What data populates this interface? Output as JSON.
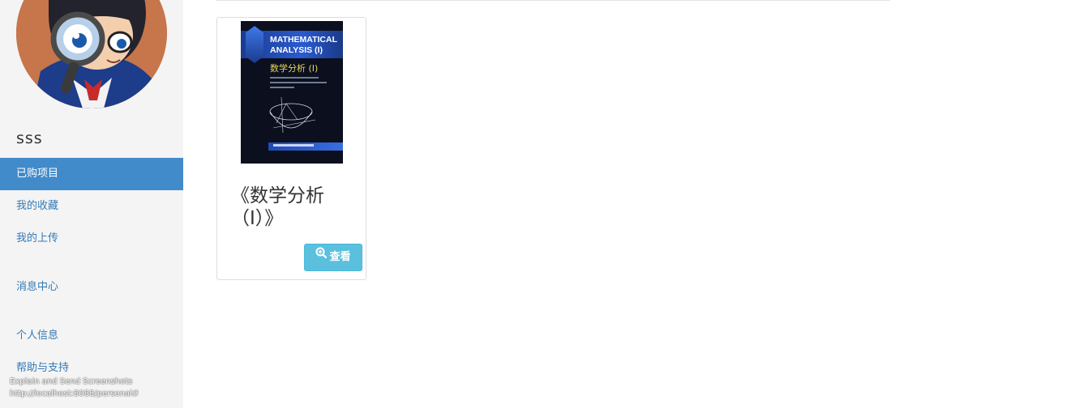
{
  "sidebar": {
    "username": "sss",
    "items": [
      {
        "label": "已购项目",
        "active": true
      },
      {
        "label": "我的收藏",
        "active": false
      },
      {
        "label": "我的上传",
        "active": false
      },
      {
        "label": "消息中心",
        "active": false
      },
      {
        "label": "个人信息",
        "active": false
      },
      {
        "label": "帮助与支持",
        "active": false
      }
    ]
  },
  "main": {
    "card": {
      "cover": {
        "title_en": "MATHEMATICAL ANALYSIS (I)",
        "title_cn": "数学分析 (I)"
      },
      "title": "《数学分析（I）》",
      "view_label": "查看"
    }
  },
  "overlay": {
    "line1": "Explain and Send Screenshots",
    "line2": "http://localhost:8088/personal#"
  },
  "colors": {
    "active_bg": "#428bca",
    "link": "#337ab7",
    "button": "#5bc0de"
  },
  "icons": {
    "view": "zoom-in-icon"
  }
}
